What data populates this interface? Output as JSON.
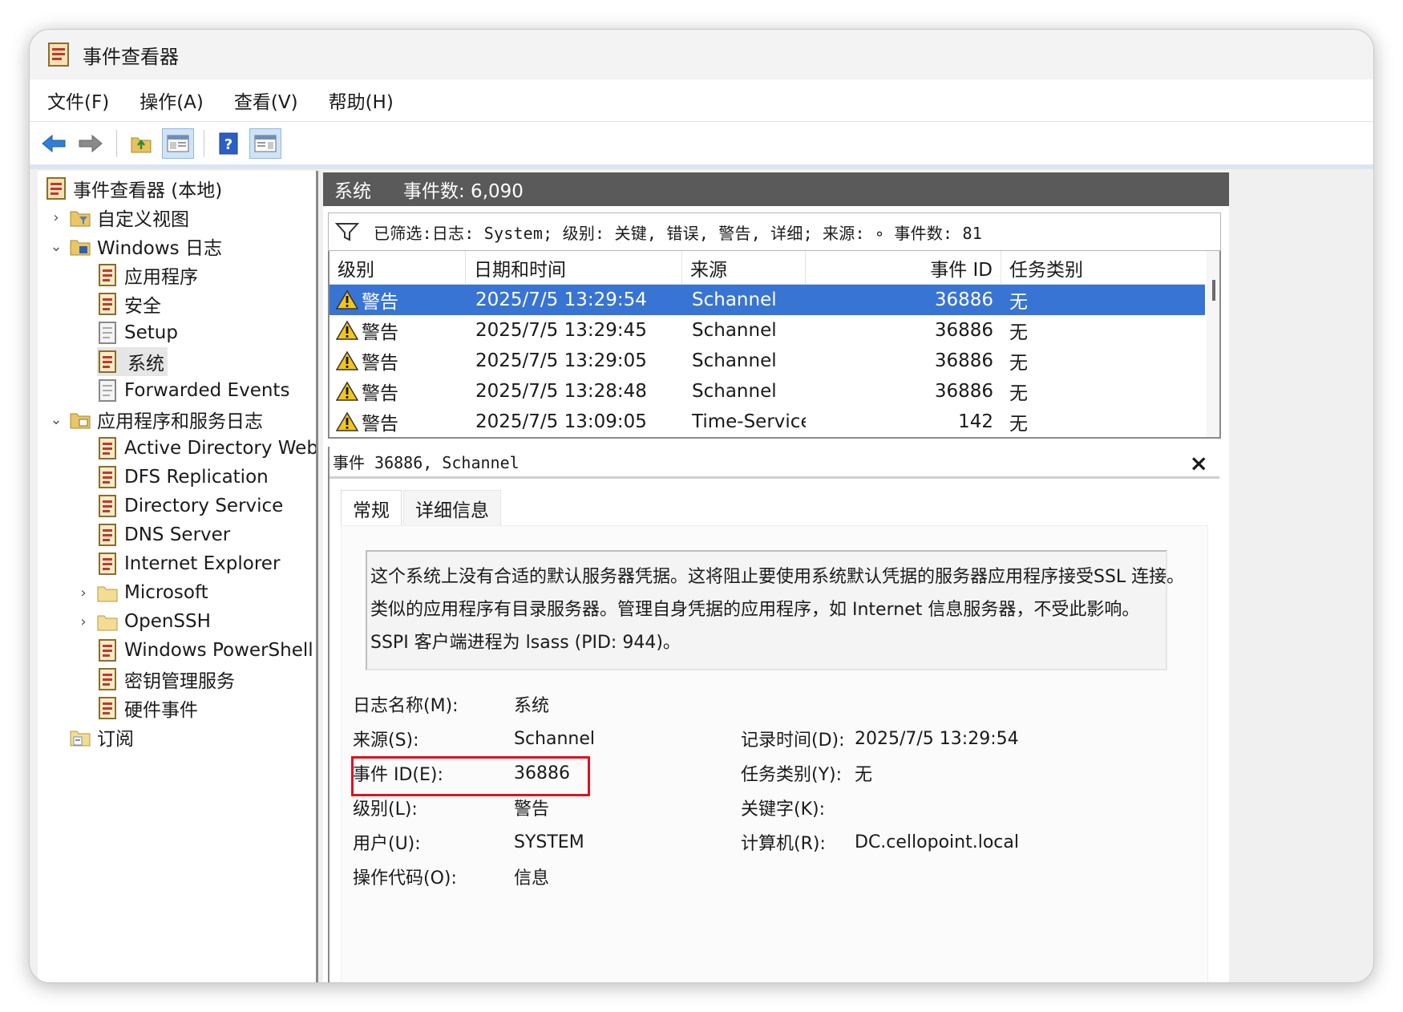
{
  "window": {
    "title": "事件查看器"
  },
  "menu": [
    "文件(F)",
    "操作(A)",
    "查看(V)",
    "帮助(H)"
  ],
  "tree": {
    "root": "事件查看器 (本地)",
    "custom_views": "自定义视图",
    "windows_logs": "Windows 日志",
    "windows_logs_items": [
      "应用程序",
      "安全",
      "Setup",
      "系统",
      "Forwarded Events"
    ],
    "app_service_logs": "应用程序和服务日志",
    "app_service_items": [
      "Active Directory Web S",
      "DFS Replication",
      "Directory Service",
      "DNS Server",
      "Internet Explorer",
      "Microsoft",
      "OpenSSH",
      "Windows PowerShell",
      "密钥管理服务",
      "硬件事件"
    ],
    "subscriptions": "订阅"
  },
  "panel": {
    "name": "系统",
    "count": "事件数: 6,090",
    "filter": "已筛选:日志: System; 级别: 关键, 错误, 警告, 详细; 来源: ∘ 事件数: 81"
  },
  "grid": {
    "headers": [
      "级别",
      "日期和时间",
      "来源",
      "事件 ID",
      "任务类别"
    ],
    "rows": [
      {
        "level": "警告",
        "datetime": "2025/7/5 13:29:54",
        "source": "Schannel",
        "event_id": "36886",
        "category": "无"
      },
      {
        "level": "警告",
        "datetime": "2025/7/5 13:29:45",
        "source": "Schannel",
        "event_id": "36886",
        "category": "无"
      },
      {
        "level": "警告",
        "datetime": "2025/7/5 13:29:05",
        "source": "Schannel",
        "event_id": "36886",
        "category": "无"
      },
      {
        "level": "警告",
        "datetime": "2025/7/5 13:28:48",
        "source": "Schannel",
        "event_id": "36886",
        "category": "无"
      },
      {
        "level": "警告",
        "datetime": "2025/7/5 13:09:05",
        "source": "Time-Service",
        "event_id": "142",
        "category": "无"
      }
    ]
  },
  "detail": {
    "title": "事件 36886, Schannel",
    "close": "×",
    "tabs": [
      "常规",
      "详细信息"
    ],
    "message": [
      "这个系统上没有合适的默认服务器凭据。这将阻止要使用系统默认凭据的服务器应用程序接受SSL 连接。",
      "类似的应用程序有目录服务器。管理自身凭据的应用程序，如 Internet 信息服务器，不受此影响。",
      "SSPI 客户端进程为 lsass (PID: 944)。"
    ],
    "props": {
      "log_name_label": "日志名称(M):",
      "log_name": "系统",
      "source_label": "来源(S):",
      "source": "Schannel",
      "logged_label": "记录时间(D):",
      "logged": "2025/7/5 13:29:54",
      "event_id_label": "事件 ID(E):",
      "event_id": "36886",
      "task_label": "任务类别(Y):",
      "task": "无",
      "level_label": "级别(L):",
      "level": "警告",
      "keywords_label": "关键字(K):",
      "keywords": "",
      "user_label": "用户(U):",
      "user": "SYSTEM",
      "computer_label": "计算机(R):",
      "computer": "DC.cellopoint.local",
      "opcode_label": "操作代码(O):",
      "opcode": "信息"
    }
  },
  "colors": {
    "selection": "#3874d3",
    "highlight_box": "#e0111e",
    "header_bar": "#5a5a5a"
  }
}
